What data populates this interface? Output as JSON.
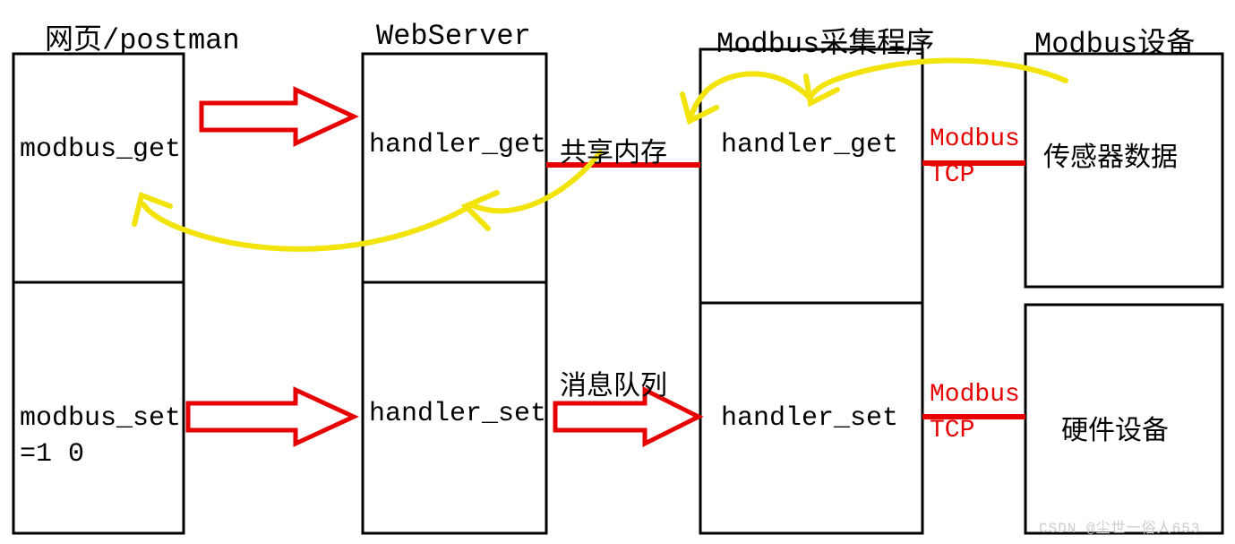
{
  "headers": {
    "col1": "网页/postman",
    "col2": "WebServer",
    "col3": "Modbus采集程序",
    "col4": "Modbus设备"
  },
  "col1": {
    "r1": "modbus_get",
    "r2a": "modbus_set",
    "r2b": "=1 0"
  },
  "col2": {
    "r1": "handler_get",
    "r2": "handler_set"
  },
  "mid": {
    "shared_mem": "共享内存",
    "msg_queue": "消息队列"
  },
  "col3": {
    "r1": "handler_get",
    "r2": "handler_set"
  },
  "proto": {
    "modbus": "Modbus",
    "tcp": "TCP"
  },
  "col4": {
    "r1": "传感器数据",
    "r2": "硬件设备"
  },
  "watermark": "CSDN @尘世一俗人653"
}
